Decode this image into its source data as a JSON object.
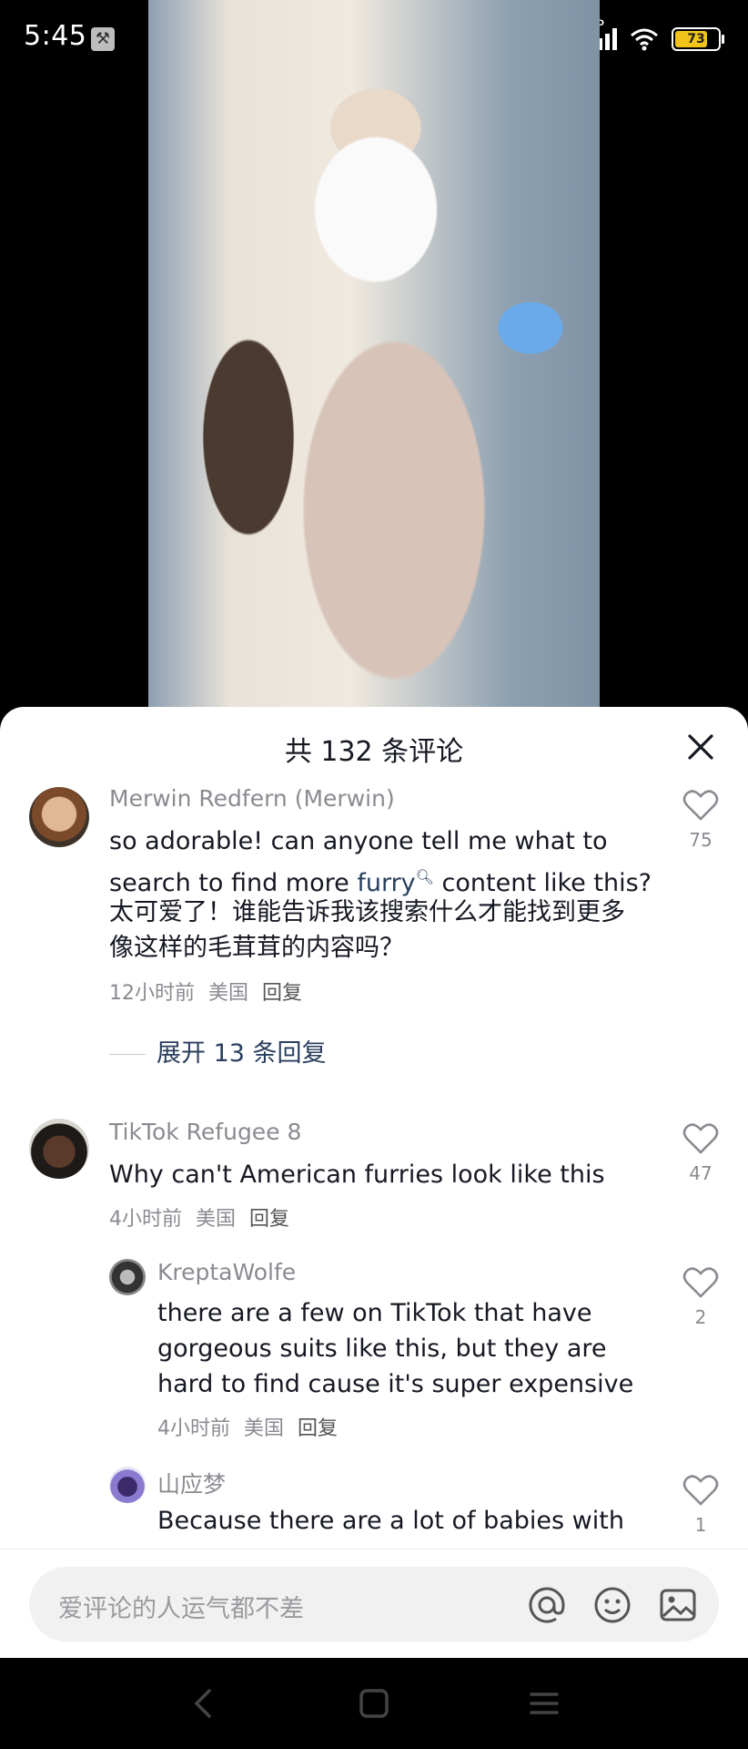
{
  "status_bar": {
    "time": "5:45",
    "battery": "73",
    "network_label": "HD"
  },
  "comments_panel": {
    "title": "共 132 条评论",
    "comments": [
      {
        "username": "Merwin Redfern (Merwin)",
        "text_before": "so adorable! can anyone tell me what to search to find more ",
        "keyword": "furry",
        "text_after": " content like this?",
        "translation": "太可爱了！谁能告诉我该搜索什么才能找到更多像这样的毛茸茸的内容吗？",
        "time": "12小时前",
        "location": "美国",
        "reply_label": "回复",
        "likes": "75",
        "expand_label": "展开 13 条回复"
      },
      {
        "username": "TikTok Refugee 8",
        "text": "Why can't American furries look like this",
        "time": "4小时前",
        "location": "美国",
        "reply_label": "回复",
        "likes": "47"
      },
      {
        "username": "KreptaWolfe",
        "text": "there are a few on TikTok that have gorgeous suits like this, but they are hard to find cause it's super expensive",
        "time": "4小时前",
        "location": "美国",
        "reply_label": "回复",
        "likes": "2"
      },
      {
        "username": "山应梦",
        "text": "Because there are a lot of babies with",
        "likes": "1"
      }
    ]
  },
  "input_bar": {
    "placeholder": "爱评论的人运气都不差"
  },
  "colors": {
    "accent_link": "#2a3e5e",
    "muted": "#8a8b91",
    "text": "#161823"
  }
}
